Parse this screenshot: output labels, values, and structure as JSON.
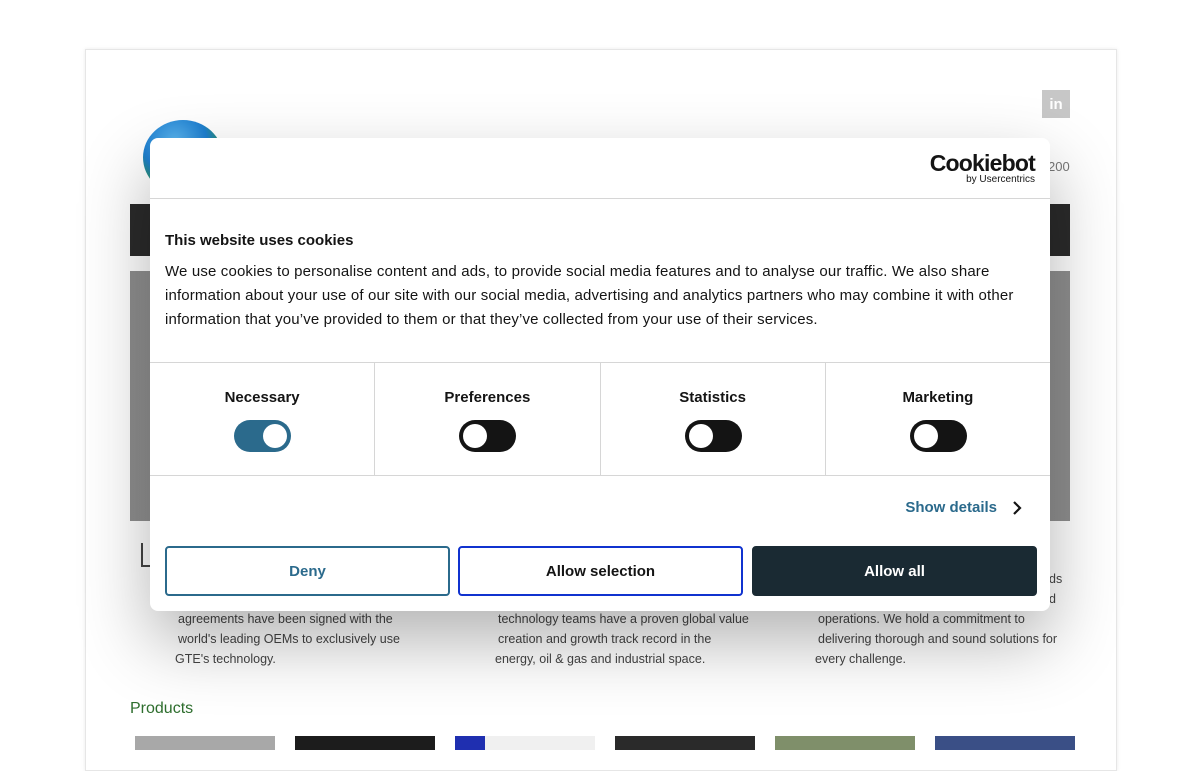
{
  "background": {
    "linkedin_glyph": "in",
    "phone_fragment": "200",
    "features": [
      {
        "lines": [
          "agreements have been signed with the",
          "world's leading OEMs to exclusively use",
          "GTE's technology."
        ]
      },
      {
        "lines": [
          "technology teams have a proven global value",
          "creation and growth track record in the",
          "energy, oil & gas and industrial space."
        ]
      },
      {
        "lines": [
          "operations. We hold a commitment to",
          "delivering thorough and sound solutions for",
          "every challenge."
        ]
      }
    ],
    "feature3_overflow": [
      "ds",
      "d"
    ],
    "products_heading": "Products"
  },
  "cookie_dialog": {
    "brand_main": "Cookiebot",
    "brand_sub": "by Usercentrics",
    "title": "This website uses cookies",
    "text": "We use cookies to personalise content and ads, to provide social media features and to analyse our traffic. We also share information about your use of our site with our social media, advertising and analytics partners who may combine it with other information that you’ve provided to them or that they’ve collected from your use of their services.",
    "categories": [
      {
        "label": "Necessary",
        "enabled": true
      },
      {
        "label": "Preferences",
        "enabled": false
      },
      {
        "label": "Statistics",
        "enabled": false
      },
      {
        "label": "Marketing",
        "enabled": false
      }
    ],
    "show_details": "Show details",
    "buttons": {
      "deny": "Deny",
      "allow_selection": "Allow selection",
      "allow_all": "Allow all"
    }
  },
  "colors": {
    "accent": "#2b6a8c",
    "dark_button": "#1a2a33",
    "selection_border": "#1032cf",
    "products_heading": "#2e6e2e"
  },
  "icons": [
    "linkedin-icon",
    "chevron-right-icon"
  ]
}
